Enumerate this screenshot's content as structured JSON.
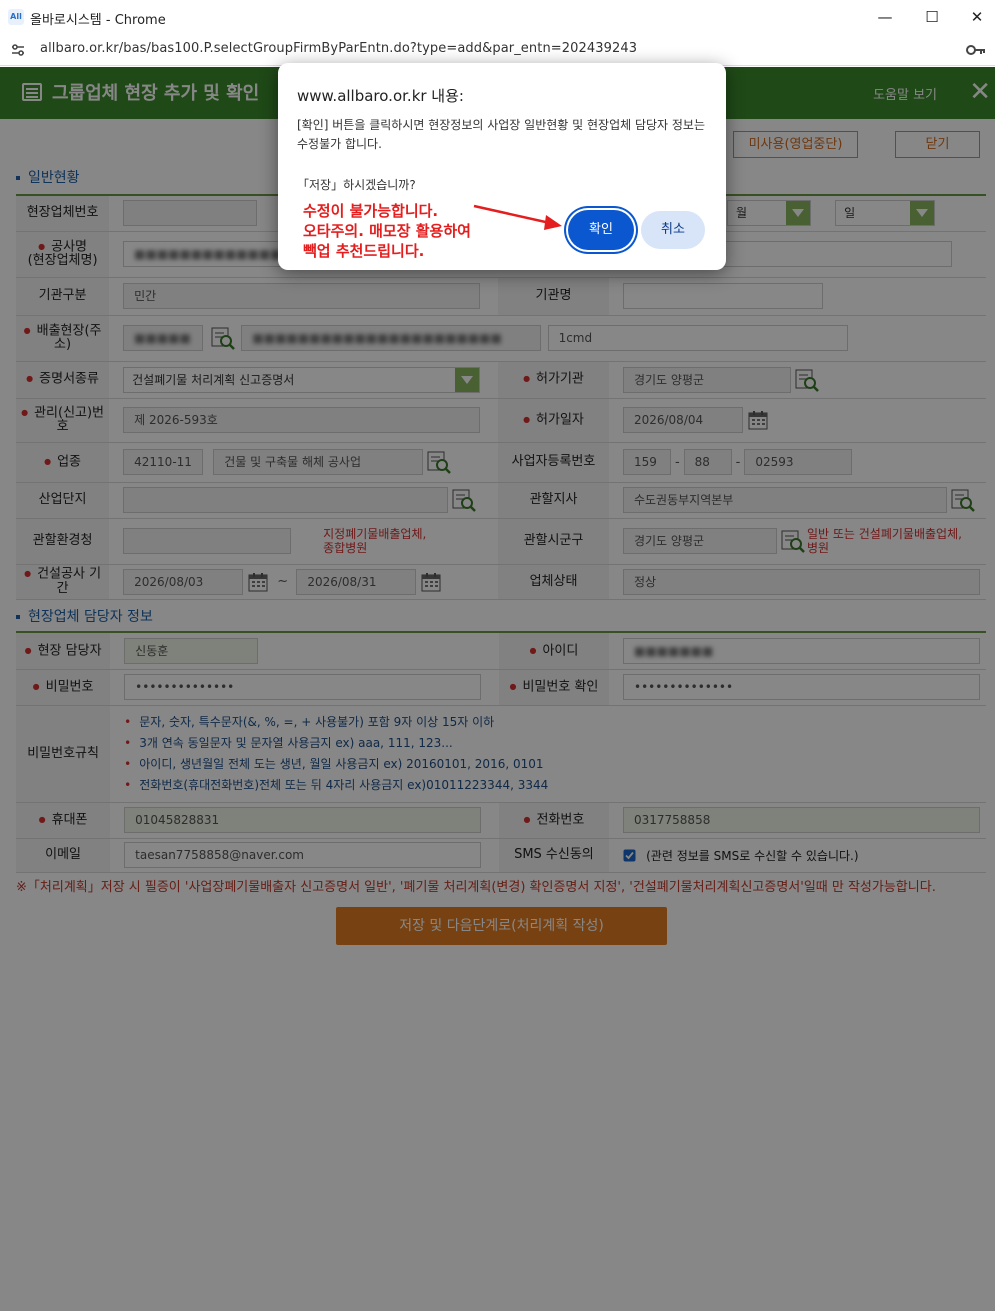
{
  "window": {
    "title": "올바로시스템 - Chrome",
    "app_icon_text": "All",
    "url": "allbaro.or.kr/bas/bas100.P.selectGroupFirmByParEntn.do?type=add&par_entn=202439243"
  },
  "header": {
    "title": "그룹업체 현장 추가 및 확인",
    "help": "도움말 보기",
    "close": "✕"
  },
  "topbuttons": {
    "suspend": "미사용(영업중단)",
    "close": "닫기"
  },
  "sections": {
    "general": "일반현황",
    "contact": "현장업체 담당자 정보"
  },
  "general": {
    "site_no_label": "현장업체번호",
    "site_no_value": "",
    "date_sel_month": "월",
    "date_sel_day": "일",
    "name_label": "공사명\n(현장업체명)",
    "name_value": "■■■■■■■■■■■■■■■",
    "org_type_label": "기관구분",
    "org_type_value": "민간",
    "org_name_label": "기관명",
    "org_name_value": "",
    "emit_site_label": "배출현장(주소)",
    "emit_site_code": "■■■■■",
    "emit_site_addr": "■■■■■■■■■■■■■■■■■■■■■■",
    "emit_site_detail": "1cmd",
    "cert_label": "증명서종류",
    "cert_value": "건설폐기물 처리계획 신고증명서",
    "auth_label": "허가기관",
    "auth_value": "경기도 양평군",
    "mgmt_label": "관리(신고)번호",
    "mgmt_value": "제  2026-593호",
    "permit_date_label": "허가일자",
    "permit_date_value": "2026/08/04",
    "industry_label": "업종",
    "industry_code": "42110-11",
    "industry_name": "건물 및 구축물 해체 공사업",
    "bizno_label": "사업자등록번호",
    "bizno_1": "159",
    "bizno_2": "88",
    "bizno_3": "02593",
    "complex_label": "산업단지",
    "complex_value": "",
    "branch_label": "관할지사",
    "branch_value": "수도권동부지역본부",
    "env_office_label": "관할환경청",
    "env_office_value": "",
    "env_office_note": "지정폐기물배출업체,\n종합병원",
    "city_label": "관할시군구",
    "city_value": "경기도 양평군",
    "city_note": "일반 또는 건설폐기물배출업체,\n병원",
    "period_label": "건설공사 기간",
    "period_start": "2026/08/03",
    "period_tilde": "~",
    "period_end": "2026/08/31",
    "status_label": "업체상태",
    "status_value": "정상"
  },
  "contact": {
    "manager_label": "현장 담당자",
    "manager_value": "신동훈",
    "id_label": "아이디",
    "id_value": "■■■■■■■",
    "pw_label": "비밀번호",
    "pw_value": "••••••••••••••",
    "pw2_label": "비밀번호 확인",
    "pw2_value": "••••••••••••••",
    "rules_label": "비밀번호규칙",
    "rules": [
      "문자, 숫자, 특수문자(&, %, =, + 사용불가) 포함 9자 이상 15자 이하",
      "3개 연속 동일문자 및 문자열 사용금지 ex) aaa, 111, 123...",
      "아이디, 생년월일 전체 도는 생년, 월일 사용금지 ex) 20160101, 2016, 0101",
      "전화번호(휴대전화번호)전체 또는 뒤 4자리 사용금지 ex)01011223344, 3344"
    ],
    "mobile_label": "휴대폰",
    "mobile_value": "01045828831",
    "phone_label": "전화번호",
    "phone_value": "0317758858",
    "email_label": "이메일",
    "email_value": "taesan7758858@naver.com",
    "sms_label": "SMS 수신동의",
    "sms_text": "(관련 정보를 SMS로 수신할 수 있습니다.)"
  },
  "notice": "※「처리계획」저장 시 필증이 '사업장폐기물배출자 신고증명서 일반', '폐기물 처리계획(변경) 확인증명서 지정', '건설폐기물처리계획신고증명서'일때 만 작성가능합니다.",
  "save_button": "저장 및 다음단계로(처리계획 작성)",
  "dialog": {
    "title": "www.allbaro.or.kr 내용:",
    "message": "[확인] 버튼을 클릭하시면 현장정보의 사업장 일반현황 및 현장업체 담당자 정보는 수정불가 합니다.",
    "question": "「저장」하시겠습니까?",
    "ok": "확인",
    "cancel": "취소"
  },
  "annotation": {
    "line1": "수정이 불가능합니다.",
    "line2": "오타주의. 매모장 활용하여",
    "line3": "빽업 추천드립니다."
  },
  "colors": {
    "header_green": "#3c8a2c",
    "accent_orange": "#e07c20",
    "dialog_blue": "#0b57d0",
    "annotation_red": "#e41e1e"
  }
}
